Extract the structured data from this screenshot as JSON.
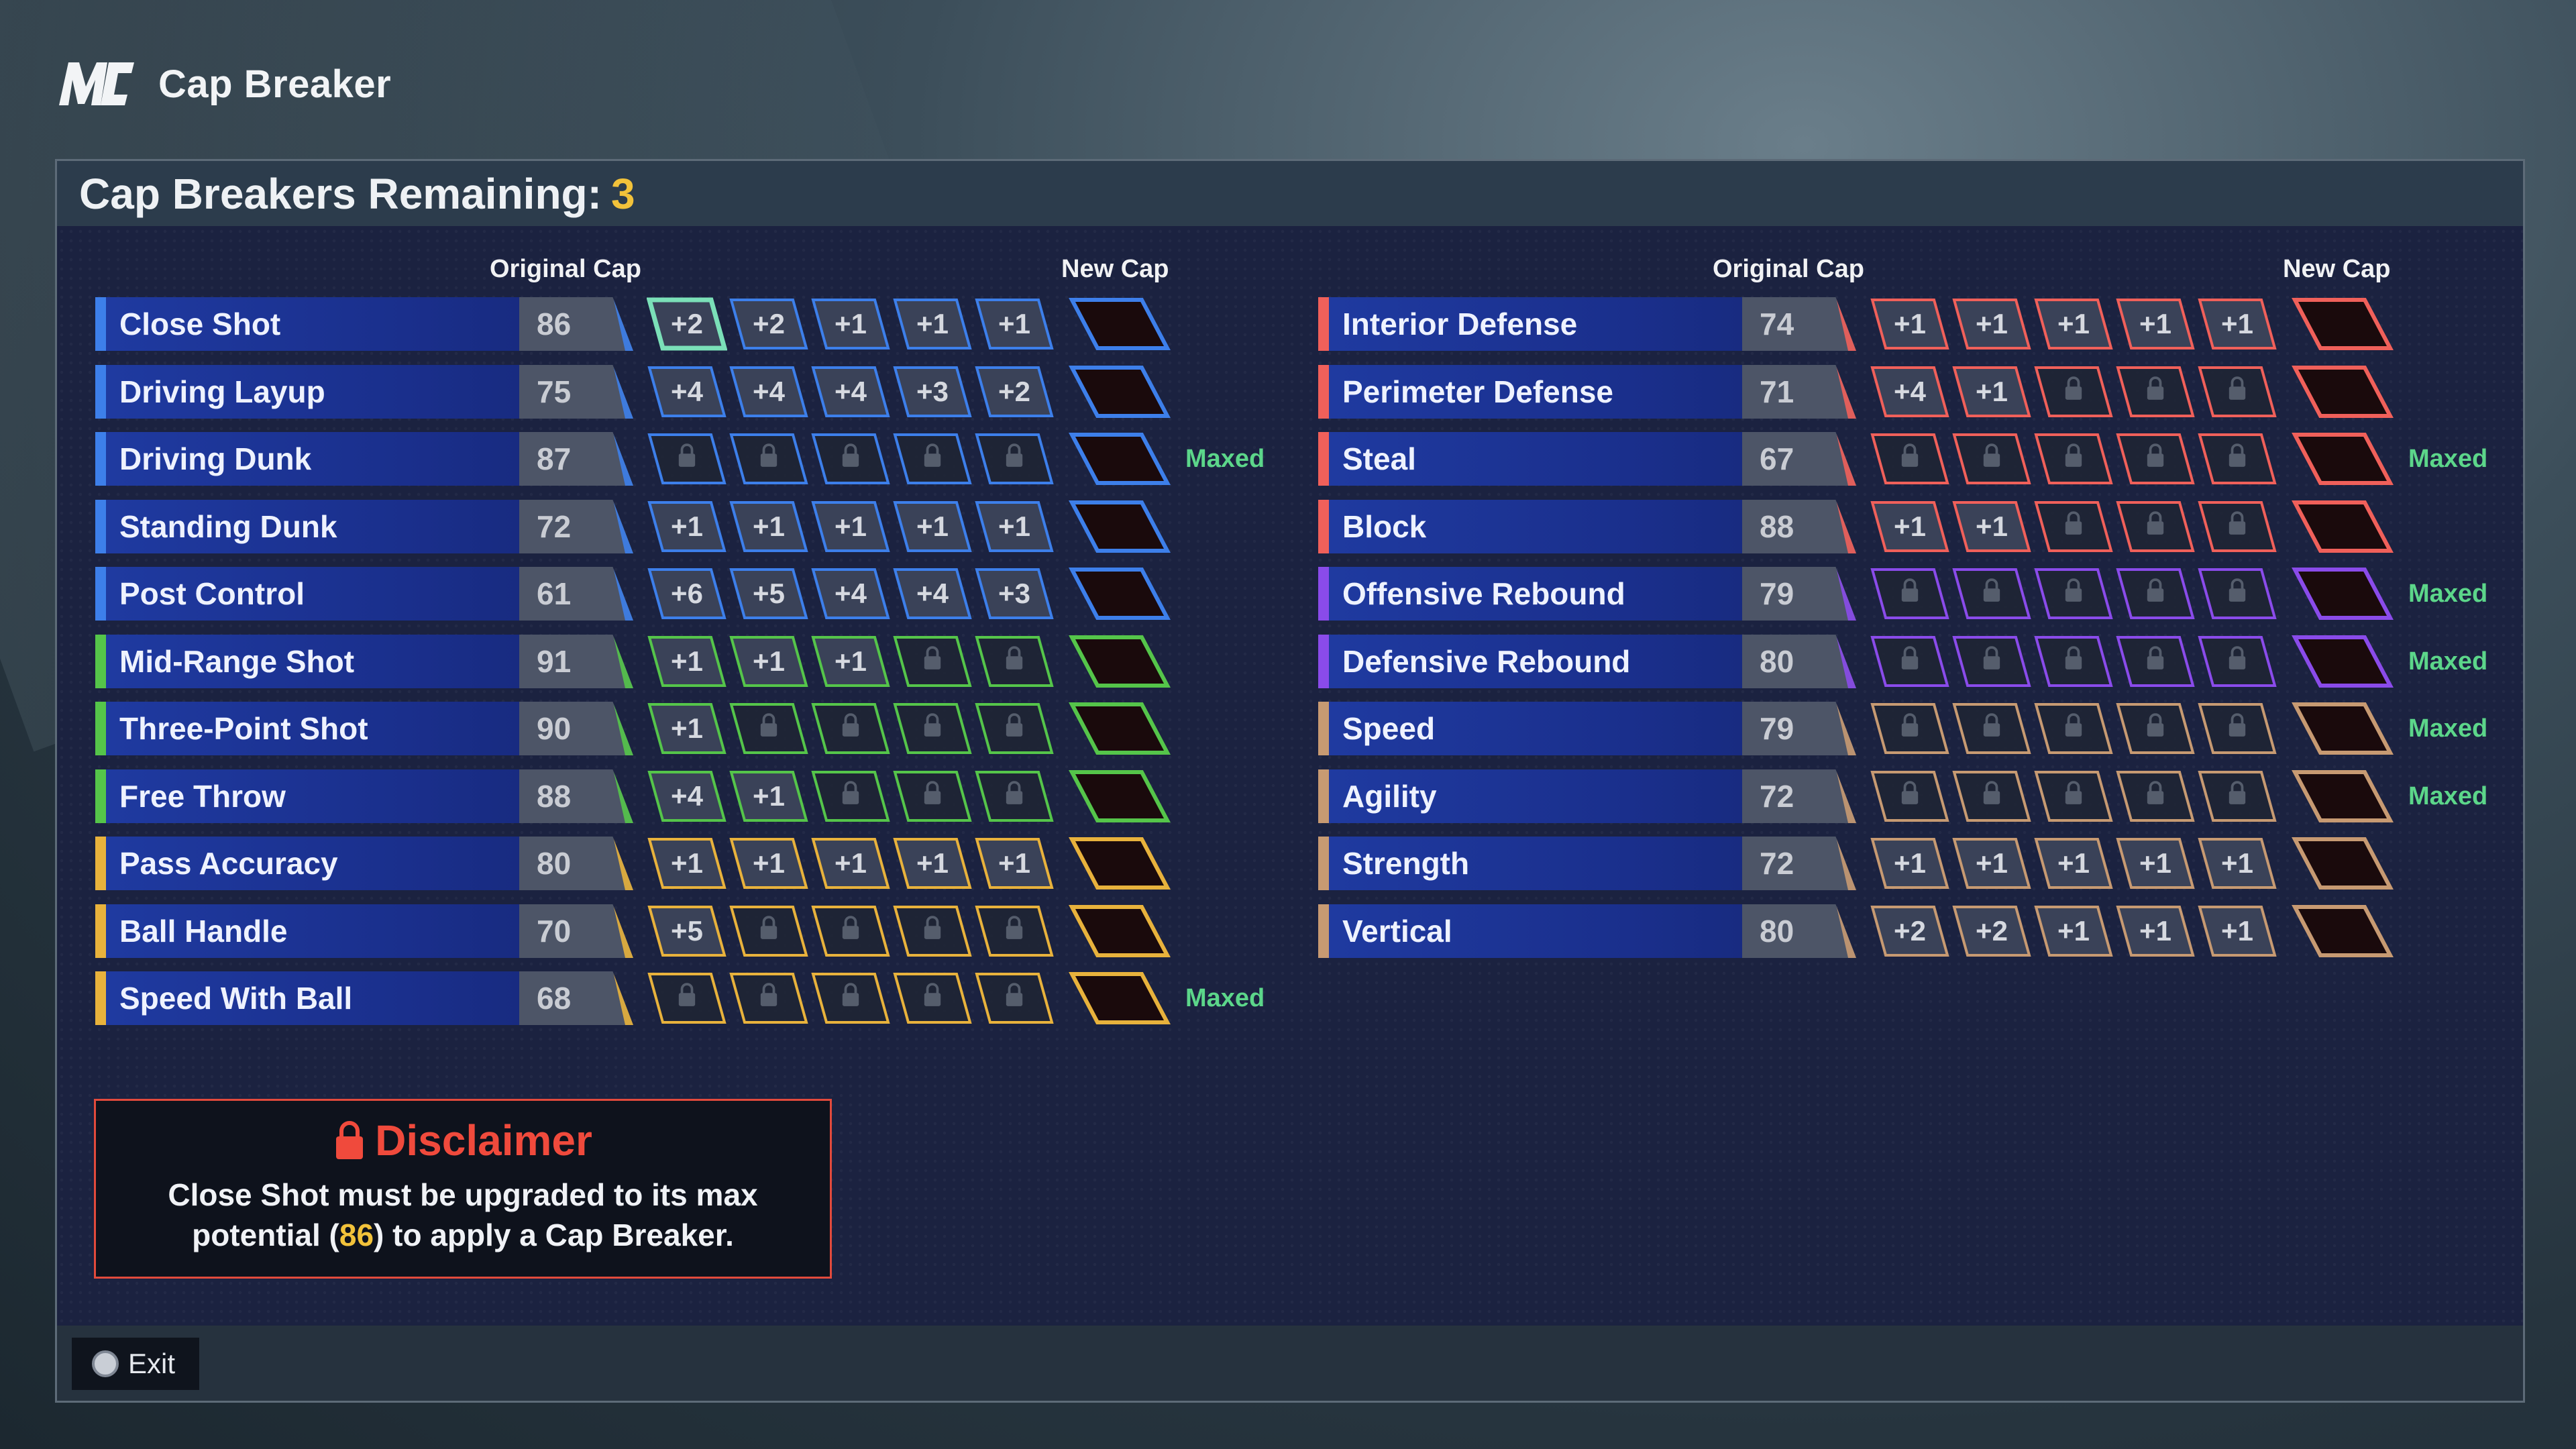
{
  "app": {
    "title": "Cap Breaker",
    "logo": "MC"
  },
  "header": {
    "label": "Cap Breakers Remaining:",
    "count": "3"
  },
  "columns": {
    "original_cap": "Original Cap",
    "new_cap": "New Cap"
  },
  "colors": {
    "inside": "#3d7fea",
    "mid": "#55c54a",
    "playmaking": "#e8b23c",
    "defense": "#f0605a",
    "rebound": "#8a4bea",
    "athletic": "#c79a72",
    "selected": "#7be0b8",
    "accent": "#f2c23a",
    "maxed": "#5cd68a"
  },
  "left_stats": [
    {
      "name": "Close Shot",
      "cap": "86",
      "locked": true,
      "color": "inside",
      "chips": [
        "+2",
        "+2",
        "+1",
        "+1",
        "+1"
      ],
      "selected": 0,
      "maxed": ""
    },
    {
      "name": "Driving Layup",
      "cap": "75",
      "locked": true,
      "color": "inside",
      "chips": [
        "+4",
        "+4",
        "+4",
        "+3",
        "+2"
      ],
      "maxed": ""
    },
    {
      "name": "Driving Dunk",
      "cap": "87",
      "locked": false,
      "color": "inside",
      "chips": [
        "lock",
        "lock",
        "lock",
        "lock",
        "lock"
      ],
      "maxed": "Maxed"
    },
    {
      "name": "Standing Dunk",
      "cap": "72",
      "locked": true,
      "color": "inside",
      "chips": [
        "+1",
        "+1",
        "+1",
        "+1",
        "+1"
      ],
      "maxed": ""
    },
    {
      "name": "Post Control",
      "cap": "61",
      "locked": true,
      "color": "inside",
      "chips": [
        "+6",
        "+5",
        "+4",
        "+4",
        "+3"
      ],
      "maxed": ""
    },
    {
      "name": "Mid-Range Shot",
      "cap": "91",
      "locked": true,
      "color": "mid",
      "chips": [
        "+1",
        "+1",
        "+1",
        "lock",
        "lock"
      ],
      "maxed": ""
    },
    {
      "name": "Three-Point Shot",
      "cap": "90",
      "locked": true,
      "color": "mid",
      "chips": [
        "+1",
        "lock",
        "lock",
        "lock",
        "lock"
      ],
      "maxed": ""
    },
    {
      "name": "Free Throw",
      "cap": "88",
      "locked": true,
      "color": "mid",
      "chips": [
        "+4",
        "+1",
        "lock",
        "lock",
        "lock"
      ],
      "maxed": ""
    },
    {
      "name": "Pass Accuracy",
      "cap": "80",
      "locked": true,
      "color": "playmaking",
      "chips": [
        "+1",
        "+1",
        "+1",
        "+1",
        "+1"
      ],
      "maxed": ""
    },
    {
      "name": "Ball Handle",
      "cap": "70",
      "locked": true,
      "color": "playmaking",
      "chips": [
        "+5",
        "lock",
        "lock",
        "lock",
        "lock"
      ],
      "maxed": ""
    },
    {
      "name": "Speed With Ball",
      "cap": "68",
      "locked": false,
      "color": "playmaking",
      "chips": [
        "lock",
        "lock",
        "lock",
        "lock",
        "lock"
      ],
      "maxed": "Maxed"
    }
  ],
  "right_stats": [
    {
      "name": "Interior Defense",
      "cap": "74",
      "locked": true,
      "color": "defense",
      "chips": [
        "+1",
        "+1",
        "+1",
        "+1",
        "+1"
      ],
      "maxed": ""
    },
    {
      "name": "Perimeter Defense",
      "cap": "71",
      "locked": true,
      "color": "defense",
      "chips": [
        "+4",
        "+1",
        "lock",
        "lock",
        "lock"
      ],
      "maxed": ""
    },
    {
      "name": "Steal",
      "cap": "67",
      "locked": false,
      "color": "defense",
      "chips": [
        "lock",
        "lock",
        "lock",
        "lock",
        "lock"
      ],
      "maxed": "Maxed"
    },
    {
      "name": "Block",
      "cap": "88",
      "locked": true,
      "color": "defense",
      "chips": [
        "+1",
        "+1",
        "lock",
        "lock",
        "lock"
      ],
      "maxed": ""
    },
    {
      "name": "Offensive Rebound",
      "cap": "79",
      "locked": false,
      "color": "rebound",
      "chips": [
        "lock",
        "lock",
        "lock",
        "lock",
        "lock"
      ],
      "maxed": "Maxed"
    },
    {
      "name": "Defensive Rebound",
      "cap": "80",
      "locked": false,
      "color": "rebound",
      "chips": [
        "lock",
        "lock",
        "lock",
        "lock",
        "lock"
      ],
      "maxed": "Maxed"
    },
    {
      "name": "Speed",
      "cap": "79",
      "locked": false,
      "color": "athletic",
      "chips": [
        "lock",
        "lock",
        "lock",
        "lock",
        "lock"
      ],
      "maxed": "Maxed"
    },
    {
      "name": "Agility",
      "cap": "72",
      "locked": false,
      "color": "athletic",
      "chips": [
        "lock",
        "lock",
        "lock",
        "lock",
        "lock"
      ],
      "maxed": "Maxed"
    },
    {
      "name": "Strength",
      "cap": "72",
      "locked": true,
      "color": "athletic",
      "chips": [
        "+1",
        "+1",
        "+1",
        "+1",
        "+1"
      ],
      "maxed": ""
    },
    {
      "name": "Vertical",
      "cap": "80",
      "locked": true,
      "color": "athletic",
      "chips": [
        "+2",
        "+2",
        "+1",
        "+1",
        "+1"
      ],
      "maxed": ""
    }
  ],
  "disclaimer": {
    "title": "Disclaimer",
    "line1": "Close Shot must be upgraded to its max",
    "line2_pre": "potential (",
    "line2_value": "86",
    "line2_post": ") to apply a Cap Breaker."
  },
  "footer": {
    "exit_label": "Exit",
    "exit_icon": "circle-button-icon"
  }
}
